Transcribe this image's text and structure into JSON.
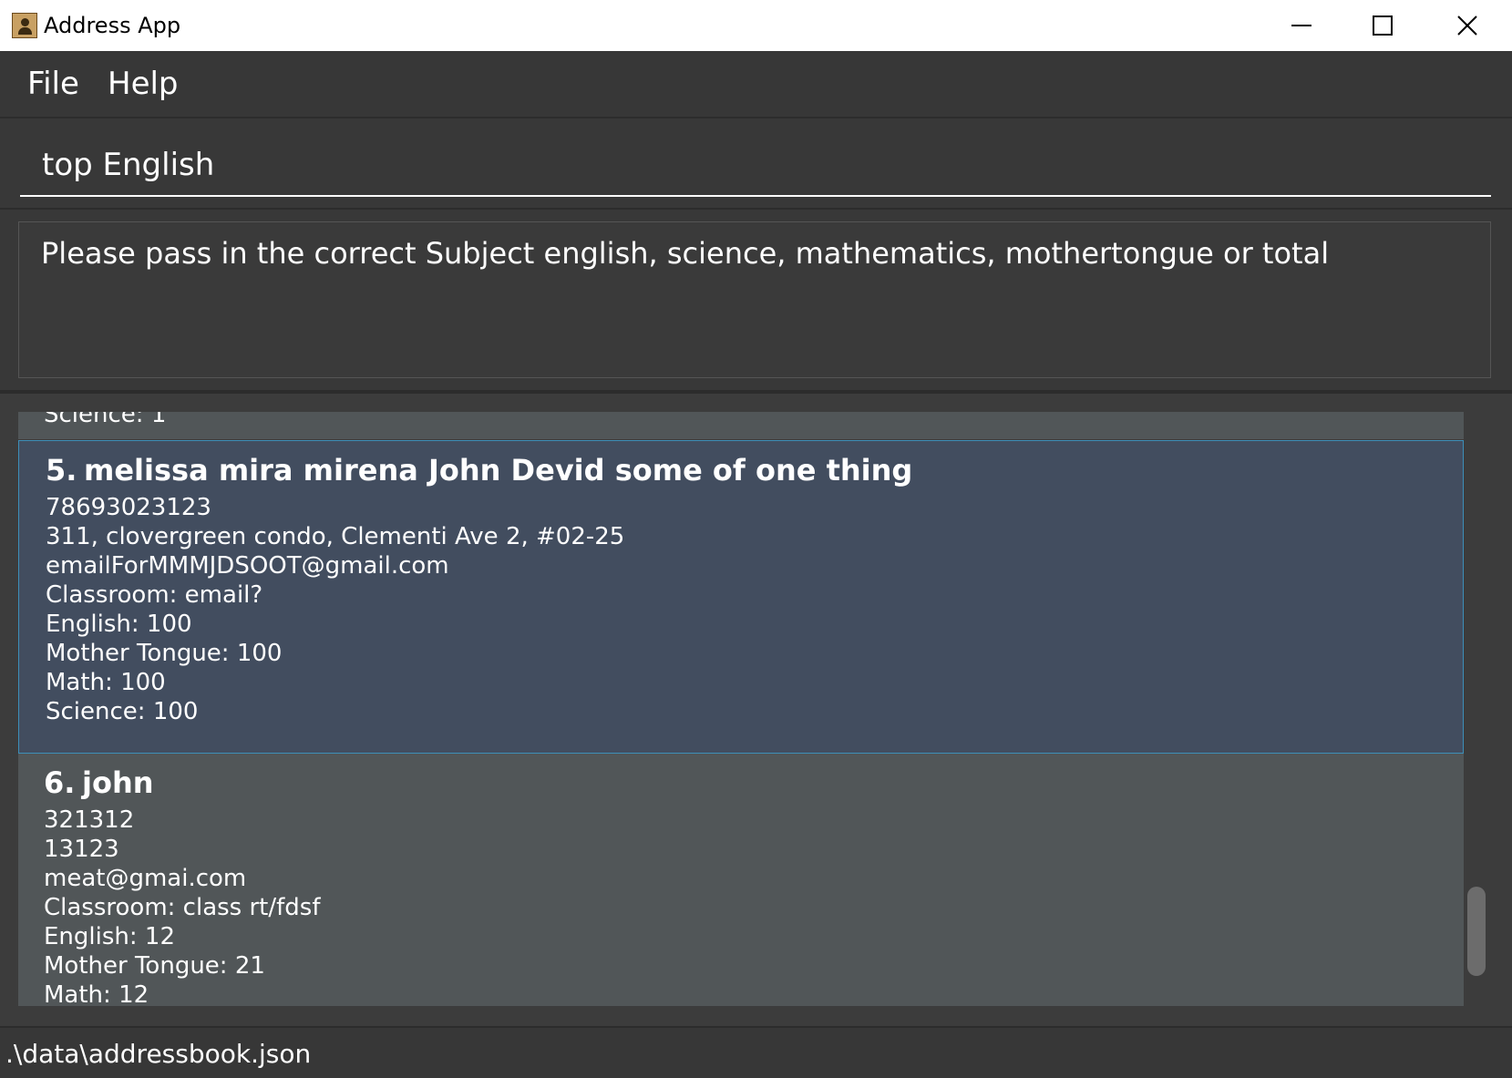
{
  "window": {
    "title": "Address App",
    "icon": "address-book-icon"
  },
  "menu": {
    "file_label": "File",
    "help_label": "Help"
  },
  "command": {
    "value": "top English"
  },
  "result": {
    "message": "Please pass in the correct Subject english, science, mathematics, mothertongue or total"
  },
  "persons": {
    "previous": {
      "science": "Science: 1"
    },
    "selected": {
      "index": "5.",
      "name": "melissa mira mirena John Devid some of one thing",
      "phone": "78693023123",
      "address": "311, clovergreen condo, Clementi Ave 2, #02-25",
      "email": "emailForMMMJDSOOT@gmail.com",
      "classroom": "Classroom: email?",
      "english": "English: 100",
      "mother_tongue": "Mother Tongue: 100",
      "math": "Math: 100",
      "science": "Science: 100"
    },
    "next": {
      "index": "6.",
      "name": "john",
      "phone": "321312",
      "address": "13123",
      "email": "meat@gmai.com",
      "classroom": "Classroom: class rt/fdsf",
      "english": "English: 12",
      "mother_tongue": "Mother Tongue: 21",
      "math": "Math: 12"
    }
  },
  "status": {
    "file_path": ".\\data\\addressbook.json"
  },
  "colors": {
    "background": "#3c3c3c",
    "selected_card": "#424d5f",
    "selected_border": "#3d8fb8",
    "card": "#515658"
  }
}
